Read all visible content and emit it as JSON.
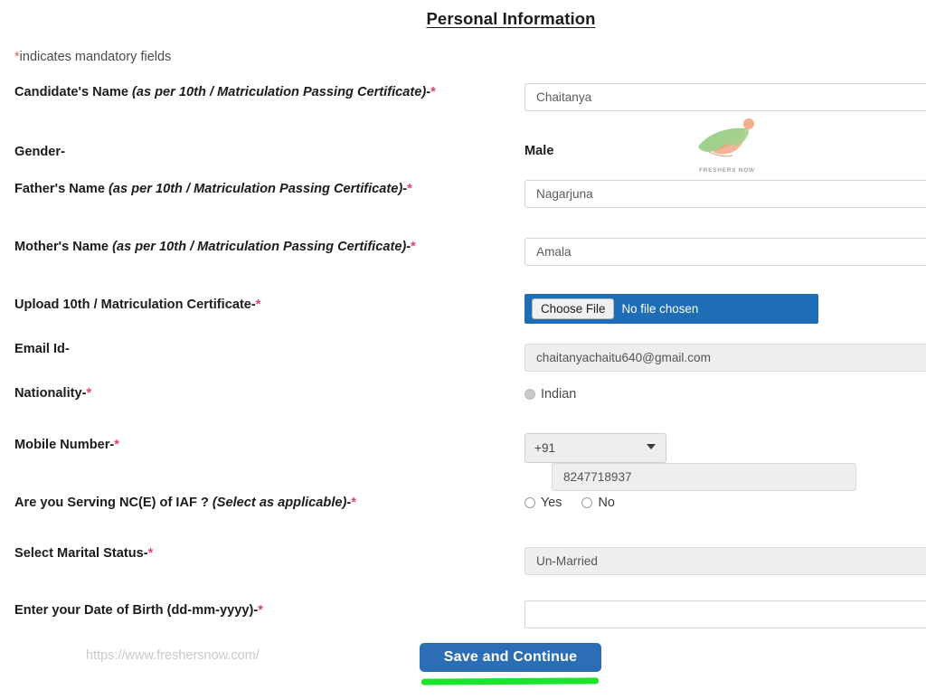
{
  "page": {
    "title": "Personal Information",
    "mandatory_note_star": "*",
    "mandatory_note": "indicates mandatory fields",
    "footer_url": "https://www.freshersnow.com/",
    "submit_label": "Save and Continue",
    "accent_blue": "#2c6eb5",
    "file_blue": "#1f6eb5",
    "required_star_color": "#e0436c",
    "highlight_green": "#1ae52a"
  },
  "watermark": {
    "name": "freshersnow-logo",
    "text": "FRESHERS NOW",
    "green": "#8fc97a",
    "orange": "#f2a07b"
  },
  "fields": [
    {
      "id": "candidate-name",
      "label_main": "Candidate's Name ",
      "label_italic": "(as per 10th / Matriculation Passing Certificate)",
      "label_tail": "-",
      "required": "*",
      "value": "Chaitanya",
      "placeholder": ""
    },
    {
      "id": "gender",
      "label_main": "Gender",
      "label_italic": "",
      "label_tail": "-",
      "required": "",
      "value": "Male",
      "placeholder": ""
    },
    {
      "id": "fathers-name",
      "label_main": "Father's Name ",
      "label_italic": "(as per 10th / Matriculation Passing Certificate)",
      "label_tail": "-",
      "required": "*",
      "value": "Nagarjuna",
      "placeholder": ""
    },
    {
      "id": "mothers-name",
      "label_main": "Mother's Name ",
      "label_italic": "(as per 10th / Matriculation Passing Certificate)",
      "label_tail": "-",
      "required": "*",
      "value": "Amala",
      "placeholder": ""
    },
    {
      "id": "upload-certificate",
      "label_main": "Upload 10th / Matriculation Certificate",
      "label_italic": "",
      "label_tail": "-",
      "required": "*",
      "choose_file_label": "Choose File",
      "file_status": "No file chosen"
    },
    {
      "id": "email-id",
      "label_main": "Email Id",
      "label_italic": "",
      "label_tail": "-",
      "required": "",
      "value": "chaitanyachaitu640@gmail.com",
      "placeholder": ""
    },
    {
      "id": "nationality",
      "label_main": "Nationality",
      "label_italic": "",
      "label_tail": "-",
      "required": "*",
      "option_label": "Indian"
    },
    {
      "id": "mobile-number",
      "label_main": "Mobile Number",
      "label_italic": "",
      "label_tail": "-",
      "required": "*",
      "country_code": "+91",
      "value": "8247718937"
    },
    {
      "id": "serving-nce-iaf",
      "label_main": "Are you Serving NC(E) of IAF ? ",
      "label_italic": "(Select as applicable)",
      "label_tail": "-",
      "required": "*",
      "option_yes": "Yes",
      "option_no": "No"
    },
    {
      "id": "marital-status",
      "label_main": "Select Marital Status",
      "label_italic": "",
      "label_tail": "-",
      "required": "*",
      "value": "Un-Married"
    },
    {
      "id": "date-of-birth",
      "label_main": "Enter your Date of Birth (dd-mm-yyyy)",
      "label_italic": "",
      "label_tail": "-",
      "required": "*",
      "value": "",
      "placeholder": ""
    }
  ]
}
